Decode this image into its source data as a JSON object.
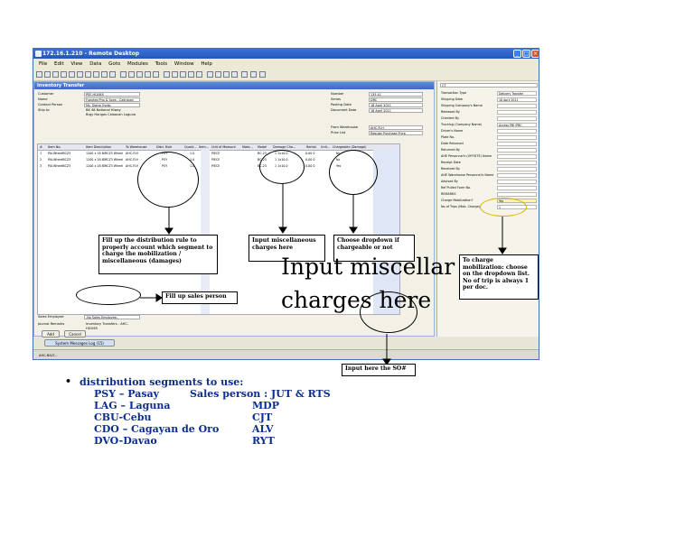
{
  "window": {
    "title": "172.16.1.210 - Remote Desktop",
    "menu": [
      "File",
      "Edit",
      "View",
      "Data",
      "Goto",
      "Modules",
      "Tools",
      "Window",
      "Help"
    ]
  },
  "form": {
    "title": "Inventory Transfer",
    "customer_label": "Customer",
    "customer_value": "PEE-HI1065",
    "name_label": "Name",
    "name_value": "Fuentes Pho & Sons - Calinigan",
    "contact_label": "Contact Person",
    "contact_value": "Ms. Diana Ovdio",
    "shipto_label": "Ship to",
    "shipto_value_1": "BK 48 National Hiway",
    "shipto_value_2": "Brgy Hongos Caloocan Laguna",
    "number_label": "Number",
    "number_value": "135 41",
    "series_label": "Series",
    "series_value": "DRC",
    "posting_label": "Posting Date",
    "posting_value": "18 April 2011",
    "docdate_label": "Document Date",
    "docdate_value": "18 April 2011",
    "fromwh_label": "From Warehouse",
    "fromwh_value": "AHC-FLH",
    "pricelist_label": "Price List",
    "pricelist_value": "Regular Purchase Price",
    "sales_emp_label": "Sales Employee",
    "sales_emp_value": "-No Sales Employee-",
    "journal_label": "Journal Remarks",
    "journal_value": "Inventory Transfers - AHC-",
    "journal_value_2": "HI1065",
    "add_button": "Add",
    "cancel_button": "Cancel"
  },
  "grid": {
    "columns": [
      "#",
      "Item No.",
      "Item Description",
      "To Warehouse",
      "Distr. Rule",
      "Quant...",
      "Item...",
      "Unit of Measure",
      "Mate...",
      "Model",
      "Damage Cha...",
      "Rental",
      "Unit...",
      "Chargeable (Damage)"
    ],
    "rows": [
      {
        "n": "1",
        "item": "PAI-WheelBCZ3",
        "desc": "1200 x 18 BIRCZ3 Wheel",
        "wh": "AHC-FLH",
        "rule": "PSY",
        "qty": "1.0",
        "uom": "PIECE",
        "model": "BC-23",
        "dmg": "1 1x10.0",
        "rent": "0.00 0",
        "unit": "0.00 000",
        "charge": "No"
      },
      {
        "n": "2",
        "item": "PAI-WheelBCZ3",
        "desc": "1200 x 18 BIRCZ3 Wheel",
        "wh": "AHC-FLH",
        "rule": "PSY",
        "qty": "1.0",
        "uom": "PIECE",
        "model": "BC-23",
        "dmg": "1 1x10.0",
        "rent": "0.00 0",
        "unit": "0.00 000",
        "charge": "No"
      },
      {
        "n": "3",
        "item": "PAI-WheelBCZ3",
        "desc": "1200 x 18 BIRCZ3 Wheel",
        "wh": "AHC-FLH",
        "rule": "PSY",
        "qty": "1.0",
        "uom": "PIECE",
        "model": "BC-23",
        "dmg": "1 1x10.0",
        "rent": "0.00 0",
        "unit": "0.00 000",
        "charge": "Yes"
      }
    ]
  },
  "right_panel": {
    "combo": "CT",
    "fields": [
      {
        "label": "Transaction Type",
        "value": "Delivery Transfer"
      },
      {
        "label": "Shipping Date",
        "value": "18 April 2011"
      },
      {
        "label": "Shipping Company's Name",
        "value": ""
      },
      {
        "label": "Released By",
        "value": ""
      },
      {
        "label": "Checked By",
        "value": ""
      },
      {
        "label": "Trucking (Company Name)",
        "value": "Access PBI (PBI)"
      },
      {
        "label": "Driver's Name",
        "value": ""
      },
      {
        "label": "Plate No.",
        "value": ""
      },
      {
        "label": "Date Returned",
        "value": ""
      },
      {
        "label": "Returned By",
        "value": ""
      },
      {
        "label": "AHE Personnel's (OFFSITE) Name",
        "value": ""
      },
      {
        "label": "Receipt Date",
        "value": ""
      },
      {
        "label": "Received By",
        "value": ""
      },
      {
        "label": "AHE Warehouse Personnel's Name",
        "value": ""
      },
      {
        "label": "Advised By",
        "value": ""
      },
      {
        "label": "Ref Pulled Form No.",
        "value": ""
      },
      {
        "label": "REMARKS",
        "value": ""
      },
      {
        "label": "Charge Mobilization?",
        "value": "Yes"
      },
      {
        "label": "No of Trips (Mob. Charge)",
        "value": "1"
      }
    ]
  },
  "taskbar": {
    "item": "System Messages Log (15)",
    "status": "AHC-BALT..."
  },
  "notes": {
    "distr": "Fill up the distribution rule to properly account which segment to charge the mobilization / miscellaneous (damages)",
    "misc": "Input miscellaneous charges here",
    "charge": "Choose dropdown if chargeable or not",
    "sales": "Fill up sales person",
    "mob": "To charge mobilization: choose on the dropdown list. No of trip is always 1 per doc.",
    "big_line1": "Input miscellar",
    "big_line2": "charges here",
    "so": "Input here the SO#"
  },
  "segments": {
    "bullet": "•",
    "heading": "distribution segments to use:",
    "sales_label": "Sales person : JUT & RTS",
    "rows": [
      {
        "code": "PSY – Pasay",
        "person": ""
      },
      {
        "code": "LAG – Laguna",
        "person": "MDP"
      },
      {
        "code": "CBU-Cebu",
        "person": "CJT"
      },
      {
        "code": "CDO – Cagayan de Oro",
        "person": "ALV"
      },
      {
        "code": "DVO-Davao",
        "person": "RYT"
      }
    ]
  }
}
